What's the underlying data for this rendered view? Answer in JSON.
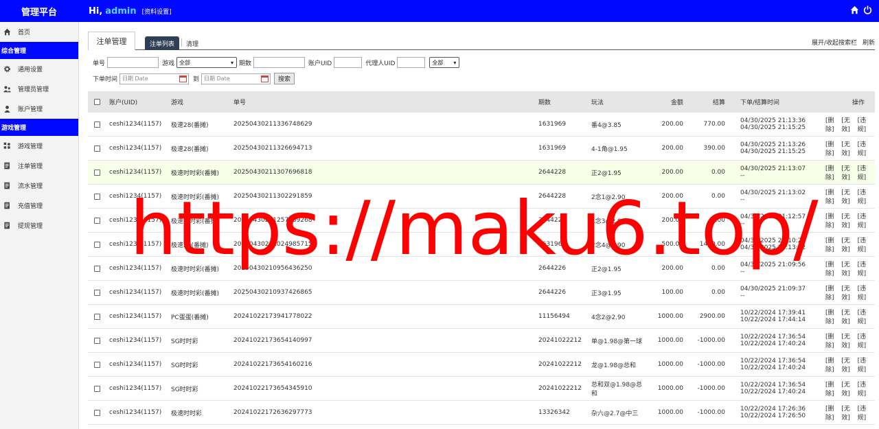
{
  "header": {
    "brand": "管理平台",
    "greeting": "Hi,",
    "username": "admin",
    "profile_link": "[资料设置]",
    "icons": [
      "home-icon",
      "power-icon"
    ]
  },
  "sidebar": {
    "items": [
      {
        "type": "item",
        "label": "首页",
        "icon": "home-icon"
      },
      {
        "type": "group",
        "label": "综合管理"
      },
      {
        "type": "item",
        "label": "通用设置",
        "icon": "gear-icon"
      },
      {
        "type": "item",
        "label": "管理员管理",
        "icon": "users-icon"
      },
      {
        "type": "item",
        "label": "账户管理",
        "icon": "user-icon"
      },
      {
        "type": "group",
        "label": "游戏管理"
      },
      {
        "type": "item",
        "label": "游戏管理",
        "icon": "grid-icon"
      },
      {
        "type": "item",
        "label": "注单管理",
        "icon": "doc-icon"
      },
      {
        "type": "item",
        "label": "流水管理",
        "icon": "doc-icon"
      },
      {
        "type": "item",
        "label": "充值管理",
        "icon": "doc-icon"
      },
      {
        "type": "item",
        "label": "提现管理",
        "icon": "doc-icon"
      }
    ]
  },
  "tabs": {
    "title": "注单管理",
    "active": "注单列表",
    "clear": "清理",
    "toggle_search": "展开/收起搜索栏",
    "refresh": "刷新"
  },
  "filters": {
    "order_no": "单号",
    "game": "游戏",
    "game_value": "全部",
    "period": "期数",
    "account_uid": "账户UID",
    "agent_uid": "代理人UID",
    "status_value": "全部",
    "order_time": "下单时间",
    "date_placeholder": "日期 Date",
    "to": "到",
    "search_button": "搜索"
  },
  "table": {
    "columns": [
      "账户(UID)",
      "游戏",
      "单号",
      "期数",
      "玩法",
      "金额",
      "结算",
      "下单/结算时间",
      "操作"
    ],
    "actions": [
      "[删除]",
      "[无效]",
      "[违规]"
    ],
    "rows": [
      {
        "account": "ceshi1234(1157)",
        "game": "极速28(番摊)",
        "order": "20250430211336748629",
        "period": "1631969",
        "play": "番4@3.85",
        "amount": "200.00",
        "settle": "770.00",
        "t1": "04/30/2025 21:13:36",
        "t2": "04/30/2025 21:15:25"
      },
      {
        "account": "ceshi1234(1157)",
        "game": "极速28(番摊)",
        "order": "20250430211326694713",
        "period": "1631969",
        "play": "4-1角@1.95",
        "amount": "200.00",
        "settle": "390.00",
        "t1": "04/30/2025 21:13:26",
        "t2": "04/30/2025 21:15:25"
      },
      {
        "account": "ceshi1234(1157)",
        "game": "极速时时彩(番摊)",
        "order": "20250430211307696818",
        "period": "2644228",
        "play": "正2@1.95",
        "amount": "200.00",
        "settle": "0.00",
        "t1": "04/30/2025 21:13:07",
        "t2": "--"
      },
      {
        "account": "ceshi1234(1157)",
        "game": "极速时时彩(番摊)",
        "order": "20250430211302291859",
        "period": "2644228",
        "play": "2念1@2.90",
        "amount": "200.00",
        "settle": "0.00",
        "t1": "04/30/2025 21:13:02",
        "t2": "--"
      },
      {
        "account": "ceshi1234(1157)",
        "game": "极速时时彩(番摊)",
        "order": "20250430211257089268",
        "period": "2644228",
        "play": "1念3@2.90",
        "amount": "200.00",
        "settle": "0.00",
        "t1": "04/30/2025 21:12:57",
        "t2": "--"
      },
      {
        "account": "ceshi1234(1157)",
        "game": "极速28(番摊)",
        "order": "20250430211024985715",
        "period": "1631969",
        "play": "2念4@2.90",
        "amount": "500.00",
        "settle": "1450.00",
        "t1": "04/30/2025 21:10:24",
        "t2": "04/30/2025 21:13:02"
      },
      {
        "account": "ceshi1234(1157)",
        "game": "极速时时彩(番摊)",
        "order": "20250430210956436250",
        "period": "2644226",
        "play": "正2@1.95",
        "amount": "200.00",
        "settle": "0.00",
        "t1": "04/30/2025 21:09:56",
        "t2": "--"
      },
      {
        "account": "ceshi1234(1157)",
        "game": "极速时时彩(番摊)",
        "order": "20250430210937426865",
        "period": "2644226",
        "play": "正3@1.95",
        "amount": "100.00",
        "settle": "0.00",
        "t1": "04/30/2025 21:09:37",
        "t2": "--"
      },
      {
        "account": "ceshi1234(1157)",
        "game": "PC蛋蛋(番摊)",
        "order": "20241022173941778022",
        "period": "11156494",
        "play": "4念2@2.90",
        "amount": "1000.00",
        "settle": "2900.00",
        "t1": "10/22/2024 17:39:41",
        "t2": "10/22/2024 17:44:14"
      },
      {
        "account": "ceshi1234(1157)",
        "game": "SG时时彩",
        "order": "20241022173654140997",
        "period": "20241022212",
        "play": "单@1.98@第一球",
        "amount": "1000.00",
        "settle": "-1000.00",
        "t1": "10/22/2024 17:36:54",
        "t2": "10/22/2024 17:40:24"
      },
      {
        "account": "ceshi1234(1157)",
        "game": "SG时时彩",
        "order": "20241022173654160216",
        "period": "20241022212",
        "play": "龙@1.98@总和",
        "amount": "1000.00",
        "settle": "-1000.00",
        "t1": "10/22/2024 17:36:54",
        "t2": "10/22/2024 17:40:24"
      },
      {
        "account": "ceshi1234(1157)",
        "game": "SG时时彩",
        "order": "20241022173654345910",
        "period": "20241022212",
        "play": "总和双@1.98@总和",
        "amount": "1000.00",
        "settle": "-1000.00",
        "t1": "10/22/2024 17:36:54",
        "t2": "10/22/2024 17:40:24"
      },
      {
        "account": "ceshi1234(1157)",
        "game": "极速时时彩",
        "order": "20241022172636297773",
        "period": "13326342",
        "play": "杂六@2.7@中三",
        "amount": "1000.00",
        "settle": "-1000.00",
        "t1": "10/22/2024 17:26:36",
        "t2": "10/22/2024 17:26:50"
      }
    ]
  },
  "watermark": "https://maku6.top/",
  "colors": {
    "brand_blue": "#0008ff",
    "active_tab": "#2f4056",
    "highlight_row": "#f7ffe9",
    "watermark": "#ff0000"
  }
}
